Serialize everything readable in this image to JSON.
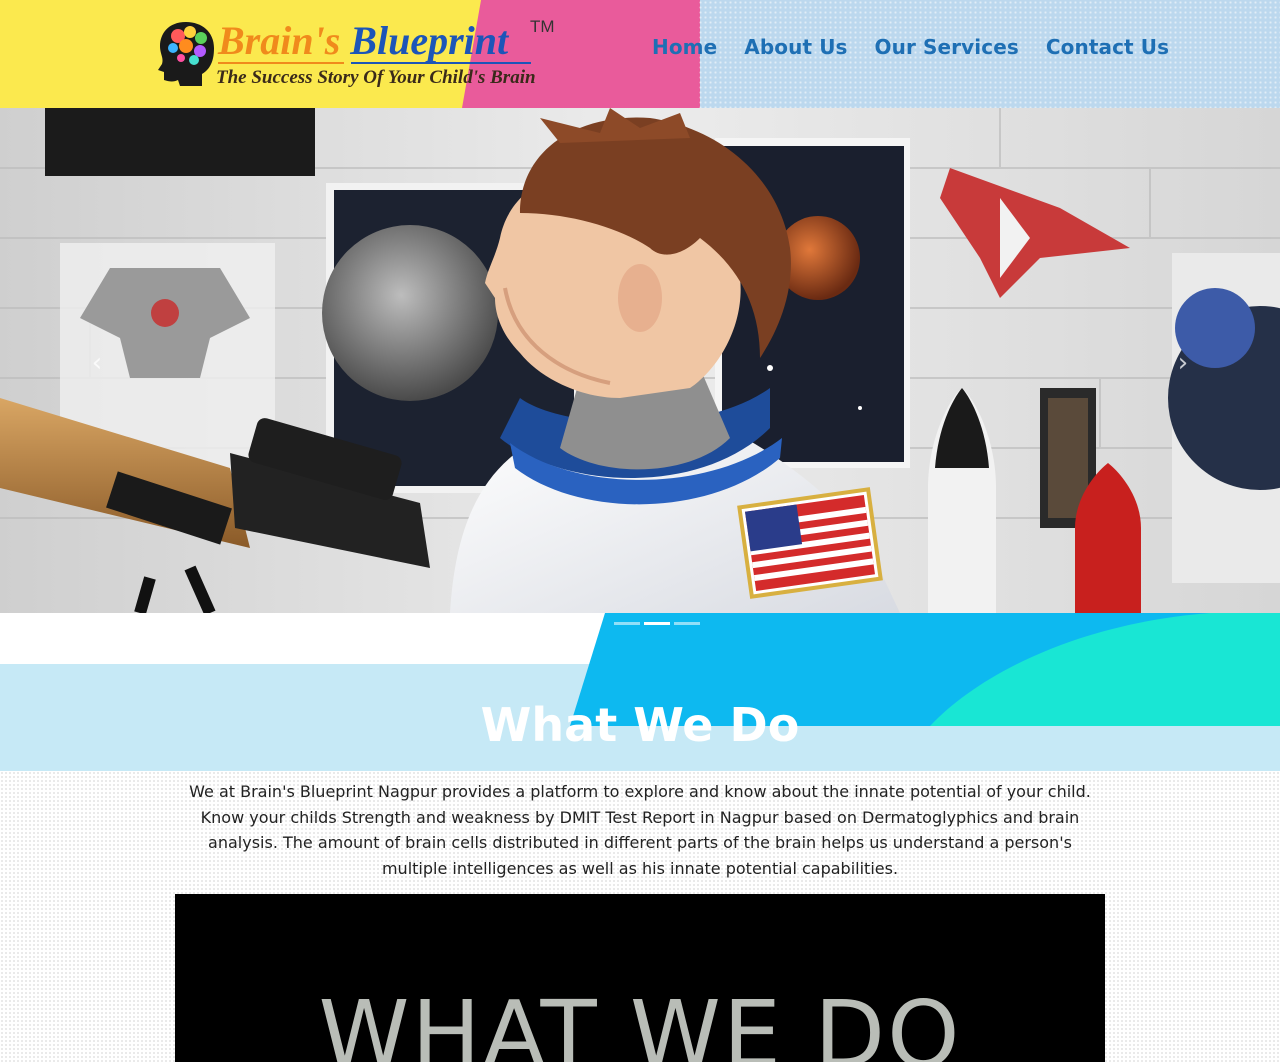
{
  "header": {
    "brand_word1": "Brain's",
    "brand_word2": "Blueprint",
    "trademark": "TM",
    "tagline": "The Success Story Of Your Child's Brain",
    "nav": [
      {
        "label": "Home"
      },
      {
        "label": "About Us"
      },
      {
        "label": "Our Services"
      },
      {
        "label": "Contact Us"
      }
    ]
  },
  "hero": {
    "prev_arrow": "‹",
    "next_arrow": "›",
    "slide_count": 3,
    "active_slide": 2
  },
  "section": {
    "title": "What We Do",
    "description": "We at Brain's Blueprint Nagpur provides a platform to explore and know about the innate potential of your child. Know your childs Strength and weakness by DMIT Test Report in Nagpur based on Dermatoglyphics and brain analysis. The amount of brain cells distributed in different parts of the brain helps us understand a person's multiple intelligences as well as his innate potential capabilities."
  },
  "video": {
    "overlay_text": "WHAT WE DO"
  },
  "colors": {
    "nav_link": "#1e6fb4",
    "header_yellow": "#fbe94e",
    "header_pink": "#e95b9b",
    "header_blue": "#bcd8ee",
    "band_blue": "#0db9f0",
    "band_cyan": "#19e6d4"
  }
}
